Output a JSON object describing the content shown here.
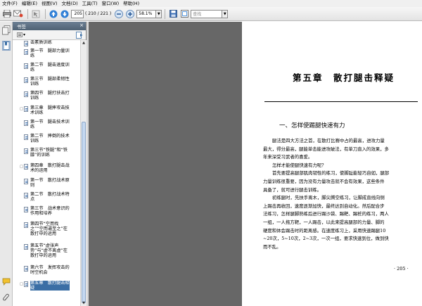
{
  "menu": [
    "文件(F)",
    "编辑(E)",
    "视图(V)",
    "文档(D)",
    "工具(T)",
    "窗口(W)",
    "帮助(H)"
  ],
  "toolbar": {
    "page_current": "205",
    "page_count": "( 210 / 221 )",
    "zoom": "58.1%",
    "find_placeholder": "查找"
  },
  "panel": {
    "title": "书签",
    "close": "×",
    "options_label": "▾"
  },
  "bookmarks": [
    {
      "label": "击素质训练",
      "level": 2,
      "toggle": "",
      "selected": false
    },
    {
      "label": "第一节　腿部力量训练",
      "level": 2,
      "toggle": "",
      "selected": false
    },
    {
      "label": "第二节　腿击速度训练",
      "level": 2,
      "toggle": "",
      "selected": false
    },
    {
      "label": "第三节　腿部柔韧性训练",
      "level": 2,
      "toggle": "",
      "selected": false
    },
    {
      "label": "第四节　腿打扶击打训练",
      "level": 2,
      "toggle": "",
      "selected": false
    },
    {
      "label": "第三章　腿摔攻击技术训练",
      "level": 1,
      "toggle": "□",
      "selected": false
    },
    {
      "label": "第一节　腿击技术训练",
      "level": 2,
      "toggle": "",
      "selected": false
    },
    {
      "label": "第二节　摔倒的技术训练",
      "level": 2,
      "toggle": "",
      "selected": false
    },
    {
      "label": "第三节“铁腿”和“铁膝”的训练",
      "level": 2,
      "toggle": "",
      "selected": false
    },
    {
      "label": "第四章　散打腿击战术的运用",
      "level": 1,
      "toggle": "□",
      "selected": false
    },
    {
      "label": "第一节　散打战术原则",
      "level": 2,
      "toggle": "",
      "selected": false
    },
    {
      "label": "第二节　散打战术特点",
      "level": 2,
      "toggle": "",
      "selected": false
    },
    {
      "label": "第三节　战术意识的作用和培养",
      "level": 2,
      "toggle": "",
      "selected": false
    },
    {
      "label": "第四节“空而找之”“空而逼至之”在散打中的运用",
      "level": 2,
      "toggle": "",
      "selected": false
    },
    {
      "label": "第五节“虚张声势”与“虚不离虚”在散打中的运用",
      "level": 2,
      "toggle": "",
      "selected": false
    },
    {
      "label": "第六节　发挥攻击的时空机会",
      "level": 2,
      "toggle": "",
      "selected": false
    },
    {
      "label": "第五章　散打腿击释疑",
      "level": 1,
      "toggle": "□",
      "selected": true
    }
  ],
  "page": {
    "chapter_title": "第五章　散打腿击释疑",
    "section_title": "一、怎样使踢腿快速有力",
    "lines": [
      "腿法是四大方法之首，在散打比赛中占的最高，进攻力量",
      "最大，得分最高，腿能单击能进攻破法，有单刀直入的效果，多",
      "年来深受习武者的喜爱。",
      "怎样才能使腿快速有力呢？",
      "首先要提高腿部肌肉韧性的练习，使脚趾能轻巧自如，腿部",
      "力量训练很重要，因为没有力量攻击就不会有效果，这些条件",
      "具备了，就可进行腿击训练。",
      "初练腿时，先扶手离木，脚尖腾空练习，让脚成直线向侧",
      "上踢击再收回，速度逐渐加快，最终达到自动化。然后配合步",
      "法练习，怎样腿脚熟练后进行踢沙袋、踢靶、踢桩的练习，两人",
      "一组，一人拖方靶，一人踢击，以此来提高腿部的力量、脚的",
      "硬度和体会踢击时的距离感。在速度练习上，采用快速踢腿10",
      "~20次，5~10次，2~3次，一次一组，要求快速到位，做到快",
      "而不乱。"
    ],
    "indent": [
      true,
      false,
      false,
      true,
      true,
      false,
      false,
      true,
      false,
      false,
      false,
      false,
      false,
      false
    ],
    "page_number": "· 205 ·"
  }
}
